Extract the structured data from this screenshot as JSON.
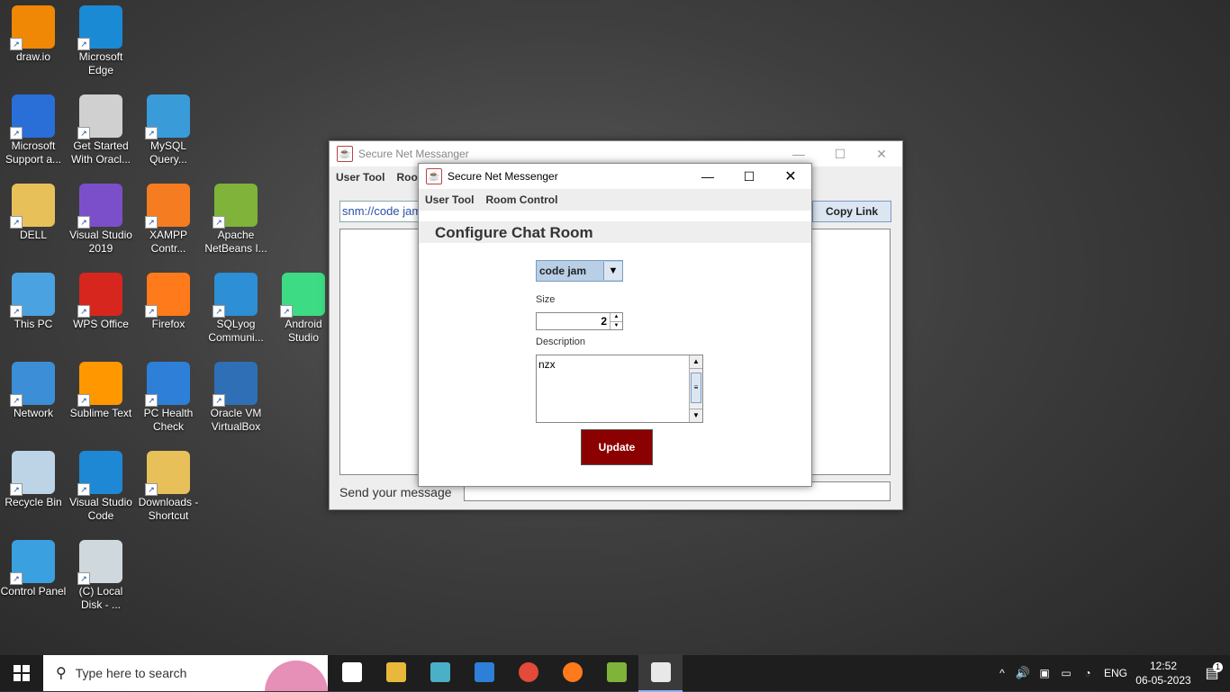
{
  "desktop_icons": [
    {
      "label": "draw.io",
      "icon": "drawio-icon",
      "color": "#f08705"
    },
    {
      "label": "Microsoft Edge",
      "icon": "edge-icon",
      "color": "#1a8ad4"
    },
    {
      "label": "Microsoft Support a...",
      "icon": "support-tools-icon",
      "color": "#2a6ed8"
    },
    {
      "label": "Get Started With Oracl...",
      "icon": "oracle-db-icon",
      "color": "#d0d0d0"
    },
    {
      "label": "MySQL Query...",
      "icon": "mysql-icon",
      "color": "#3a9bd9"
    },
    {
      "label": "DELL",
      "icon": "user-folder-icon",
      "color": "#e8c05a"
    },
    {
      "label": "Visual Studio 2019",
      "icon": "visual-studio-icon",
      "color": "#7b4fc9"
    },
    {
      "label": "XAMPP Contr...",
      "icon": "xampp-icon",
      "color": "#f57c20"
    },
    {
      "label": "Apache NetBeans I...",
      "icon": "netbeans-icon",
      "color": "#7fb33a"
    },
    {
      "label": "This PC",
      "icon": "this-pc-icon",
      "color": "#4aa3e0"
    },
    {
      "label": "WPS Office",
      "icon": "wps-office-icon",
      "color": "#d7261e"
    },
    {
      "label": "Firefox",
      "icon": "firefox-icon",
      "color": "#ff7a1a"
    },
    {
      "label": "SQLyog Communi...",
      "icon": "sqlyog-icon",
      "color": "#2d8fd5"
    },
    {
      "label": "Android Studio",
      "icon": "android-studio-icon",
      "color": "#3ddc84"
    },
    {
      "label": "Network",
      "icon": "network-icon",
      "color": "#3c8fd6"
    },
    {
      "label": "Sublime Text",
      "icon": "sublime-text-icon",
      "color": "#ff9800"
    },
    {
      "label": "PC Health Check",
      "icon": "pc-health-icon",
      "color": "#2d7fd8"
    },
    {
      "label": "Oracle VM VirtualBox",
      "icon": "virtualbox-icon",
      "color": "#2f6fb5"
    },
    {
      "label": "Recycle Bin",
      "icon": "recycle-bin-icon",
      "color": "#bcd4e6"
    },
    {
      "label": "Visual Studio Code",
      "icon": "vscode-icon",
      "color": "#1e88d4"
    },
    {
      "label": "Downloads - Shortcut",
      "icon": "downloads-folder-icon",
      "color": "#e8c05a"
    },
    {
      "label": "Control Panel",
      "icon": "control-panel-icon",
      "color": "#3aa0e0"
    },
    {
      "label": "(C) Local Disk - ...",
      "icon": "local-disk-icon",
      "color": "#cfd8dc"
    }
  ],
  "back_window": {
    "title": "Secure Net Messanger",
    "menu": [
      "User Tool",
      "Room Control"
    ],
    "link_value": "snm://code jam",
    "copy_link_label": "Copy Link",
    "send_label": "Send your message",
    "message_value": ""
  },
  "front_window": {
    "title": "Secure Net Messenger",
    "menu": [
      "User Tool",
      "Room Control"
    ],
    "heading": "Configure Chat Room",
    "room_select_value": "code jam",
    "size_label": "Size",
    "size_value": "2",
    "description_label": "Description",
    "description_value": "nzx",
    "update_label": "Update",
    "update_color": "#8b0000"
  },
  "taskbar": {
    "search_placeholder": "Type here to search",
    "language": "ENG",
    "time": "12:52",
    "date": "06-05-2023",
    "notification_count": "1",
    "pinned": [
      "task-view-icon",
      "file-explorer-icon",
      "edge-dev-icon",
      "microsoft-store-icon",
      "chrome-icon",
      "firefox-icon",
      "netbeans-icon",
      "java-app-icon"
    ]
  }
}
